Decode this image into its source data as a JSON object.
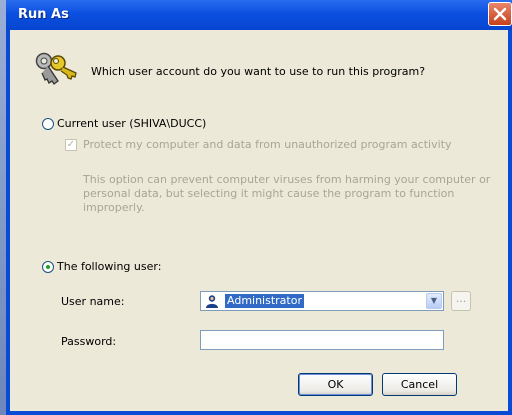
{
  "window": {
    "title": "Run As"
  },
  "dialog": {
    "question": "Which user account do you want to use to run this program?",
    "current_user": {
      "label": "Current user (SHIVA\\DUCC)",
      "selected": false
    },
    "protect": {
      "label": "Protect my computer and data from unauthorized program activity",
      "checked": true,
      "enabled": false
    },
    "description": "This option can prevent computer viruses from harming your computer or personal data, but selecting it might cause the program to function improperly.",
    "following_user": {
      "label": "The following user:",
      "selected": true
    },
    "user_name": {
      "label": "User name:",
      "value": "Administrator"
    },
    "password": {
      "label": "Password:",
      "value": ""
    },
    "browse_label": "...",
    "ok_label": "OK",
    "cancel_label": "Cancel"
  },
  "colors": {
    "title_bar": "#0b50e0",
    "dialog_face": "#ece9d8",
    "selection": "#316ac5",
    "close_button": "#c8401c"
  },
  "icons": {
    "dialog": "keys-icon",
    "user": "user-icon",
    "close": "close-icon",
    "dropdown": "chevron-down-icon"
  }
}
